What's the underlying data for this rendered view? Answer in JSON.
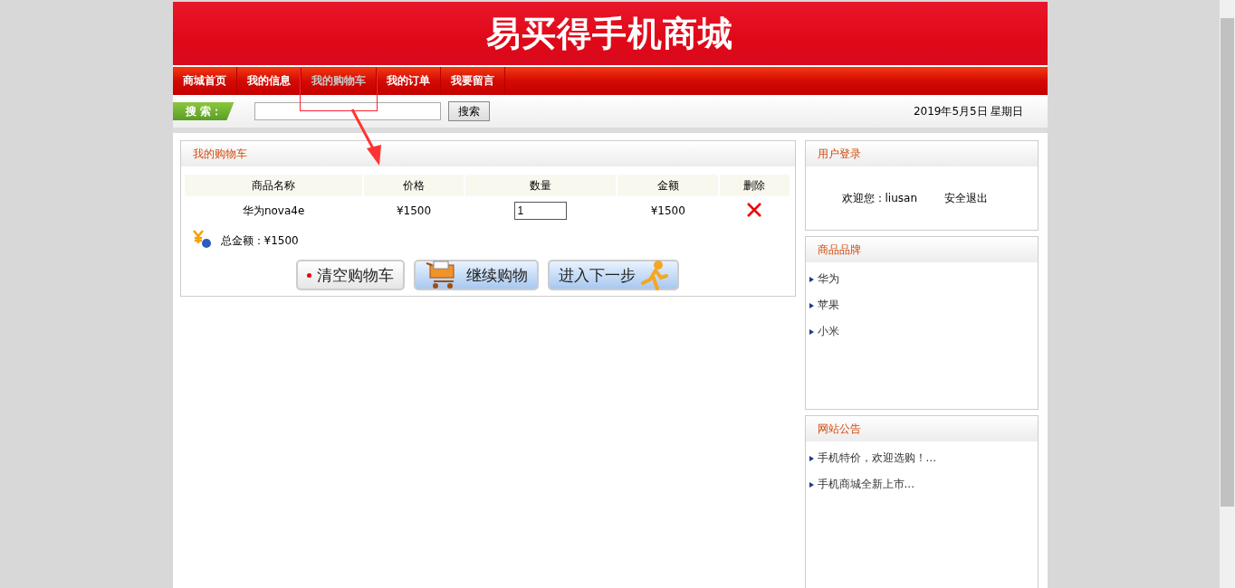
{
  "header": {
    "title": "易买得手机商城"
  },
  "nav": [
    {
      "label": "商城首页",
      "selected": false
    },
    {
      "label": "我的信息",
      "selected": false
    },
    {
      "label": "我的购物车",
      "selected": true
    },
    {
      "label": "我的订单",
      "selected": false
    },
    {
      "label": "我要留言",
      "selected": false
    }
  ],
  "search": {
    "label": "搜 索：",
    "button": "搜索",
    "date": "2019年5月5日 星期日"
  },
  "cart": {
    "title": "我的购物车",
    "columns": [
      "商品名称",
      "价格",
      "数量",
      "金额",
      "删除"
    ],
    "rows": [
      {
        "name": "华为nova4e",
        "price": "¥1500",
        "quantity": "1",
        "amount": "¥1500"
      }
    ],
    "total": "总金额：¥1500",
    "buttons": [
      {
        "kind": "clear",
        "label": "清空购物车"
      },
      {
        "kind": "continue",
        "label": "继续购物"
      },
      {
        "kind": "next",
        "label": "进入下一步"
      }
    ]
  },
  "login": {
    "title": "用户登录",
    "welcome": "欢迎您：liusan",
    "logout": "安全退出"
  },
  "brands": {
    "title": "商品品牌",
    "items": [
      "华为",
      "苹果",
      "小米"
    ]
  },
  "notices": {
    "title": "网站公告",
    "items": [
      "手机特价，欢迎选购！...",
      "手机商城全新上市..."
    ]
  }
}
